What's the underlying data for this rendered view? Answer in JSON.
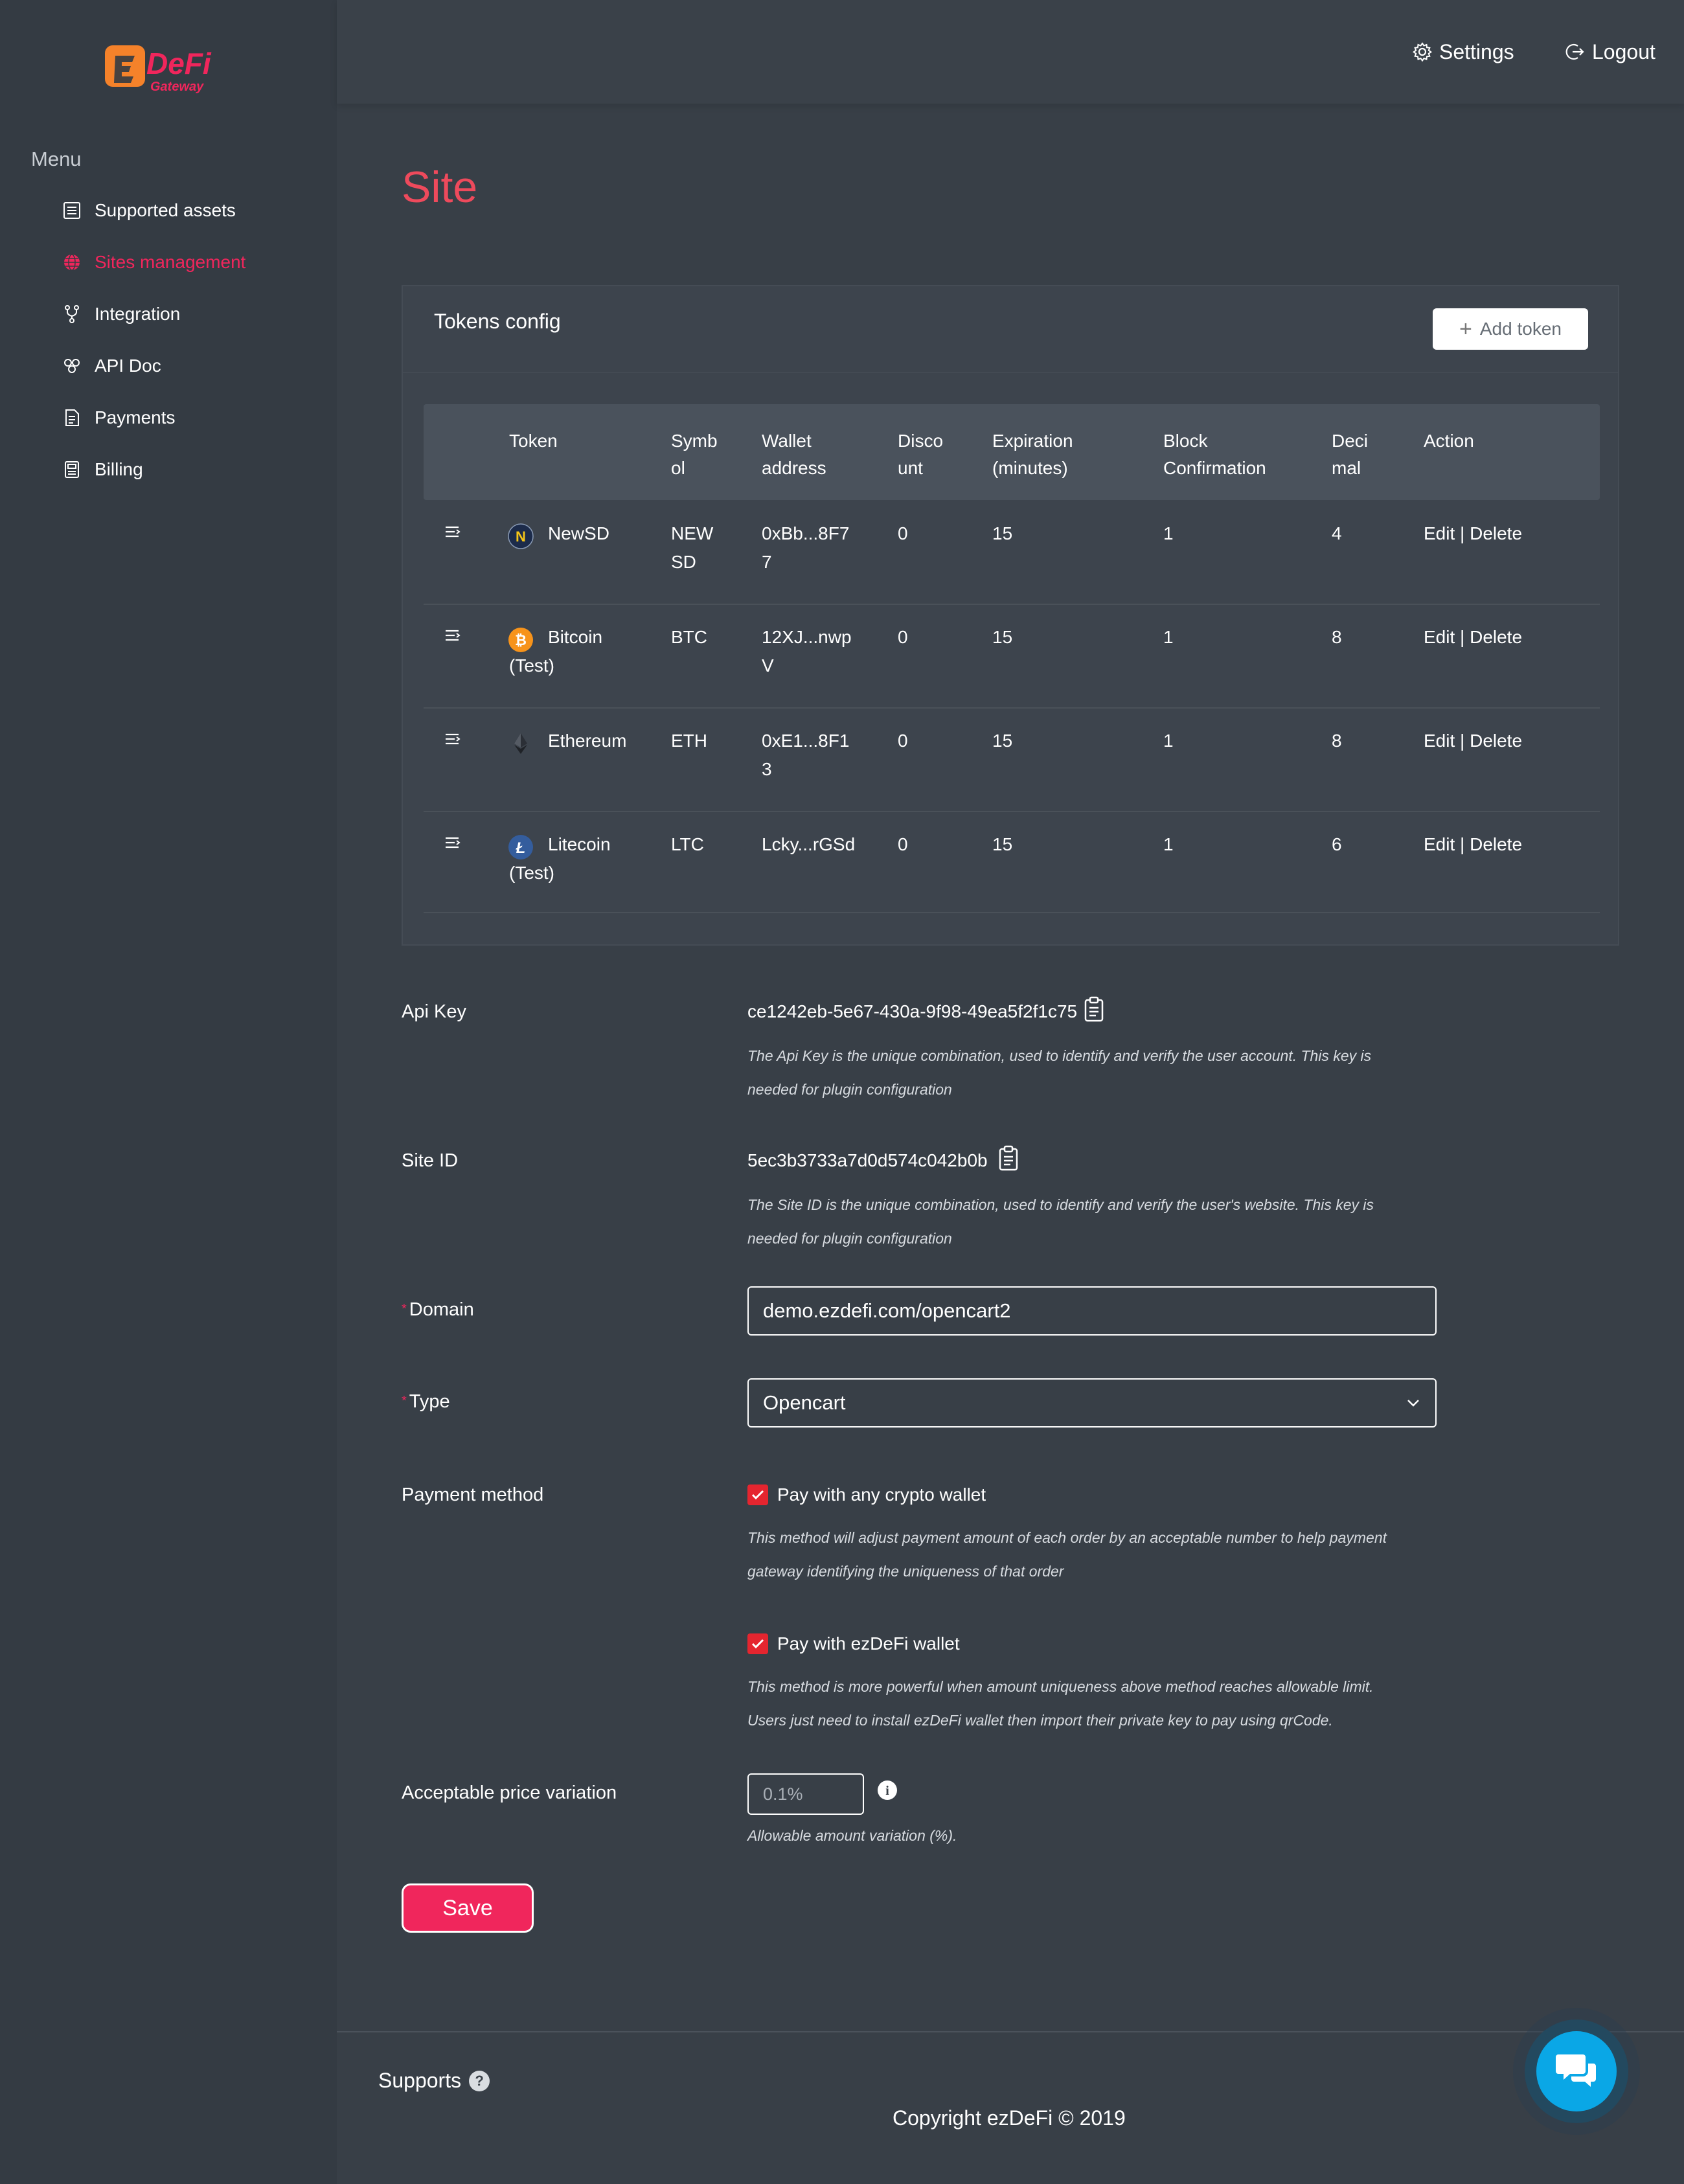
{
  "brand": {
    "logo_text": "ezDeFi",
    "logo_sub": "Gateway",
    "accent": "#f0265c",
    "logo_orange": "#f5822a"
  },
  "sidebar": {
    "menu_title": "Menu",
    "items": [
      {
        "label": "Supported assets",
        "icon": "list-icon",
        "active": false
      },
      {
        "label": "Sites management",
        "icon": "globe-icon",
        "active": true
      },
      {
        "label": "Integration",
        "icon": "fork-icon",
        "active": false
      },
      {
        "label": "API Doc",
        "icon": "api-icon",
        "active": false
      },
      {
        "label": "Payments",
        "icon": "document-icon",
        "active": false
      },
      {
        "label": "Billing",
        "icon": "receipt-icon",
        "active": false
      }
    ]
  },
  "header": {
    "settings_label": "Settings",
    "logout_label": "Logout"
  },
  "page": {
    "title": "Site"
  },
  "tokens": {
    "title": "Tokens config",
    "add_label": "Add token",
    "columns": [
      [
        "Token"
      ],
      [
        "Symb",
        "ol"
      ],
      [
        "Wallet",
        "address"
      ],
      [
        "Disco",
        "unt"
      ],
      [
        "Expiration",
        "(minutes)"
      ],
      [
        "Block",
        "Confirmation"
      ],
      [
        "Deci",
        "mal"
      ],
      [
        "Action"
      ]
    ],
    "edit_label": "Edit",
    "delete_label": "Delete",
    "rows": [
      {
        "name": [
          "NewSD"
        ],
        "coin": "newsd-coin-icon",
        "symbol": [
          "NEW",
          "SD"
        ],
        "wallet": [
          "0xBb...8F7",
          "7"
        ],
        "discount": "0",
        "expiration": "15",
        "block": "1",
        "decimal": "4"
      },
      {
        "name": [
          "Bitcoin",
          "(Test)"
        ],
        "coin": "bitcoin-coin-icon",
        "symbol": [
          "BTC"
        ],
        "wallet": [
          "12XJ...nwp",
          "V"
        ],
        "discount": "0",
        "expiration": "15",
        "block": "1",
        "decimal": "8"
      },
      {
        "name": [
          "Ethereum"
        ],
        "coin": "ethereum-coin-icon",
        "symbol": [
          "ETH"
        ],
        "wallet": [
          "0xE1...8F1",
          "3"
        ],
        "discount": "0",
        "expiration": "15",
        "block": "1",
        "decimal": "8"
      },
      {
        "name": [
          "Litecoin",
          "(Test)"
        ],
        "coin": "litecoin-coin-icon",
        "symbol": [
          "LTC"
        ],
        "wallet": [
          "Lcky...rGSd"
        ],
        "discount": "0",
        "expiration": "15",
        "block": "1",
        "decimal": "6"
      }
    ]
  },
  "form": {
    "api_key": {
      "label": "Api Key",
      "value": "ce1242eb-5e67-430a-9f98-49ea5f2f1c75",
      "hint": [
        "The Api Key is the unique combination, used to identify and verify the user account. This key is",
        "needed for plugin configuration"
      ]
    },
    "site_id": {
      "label": "Site ID",
      "value": "5ec3b3733a7d0d574c042b0b",
      "hint": [
        "The Site ID is the unique combination, used to identify and verify the user's website. This key is",
        "needed for plugin configuration"
      ]
    },
    "domain": {
      "required_mark": "*",
      "label": "Domain",
      "value": "demo.ezdefi.com/opencart2"
    },
    "type": {
      "required_mark": "*",
      "label": "Type",
      "value": "Opencart"
    },
    "payment_method": {
      "label": "Payment method",
      "any_wallet": {
        "label": "Pay with any crypto wallet",
        "checked": true,
        "hint": [
          "This method will adjust payment amount of each order by an acceptable number to help payment",
          "gateway identifying the uniqueness of that order"
        ]
      },
      "ezdefi_wallet": {
        "label": "Pay with ezDeFi wallet",
        "checked": true,
        "hint": [
          "This method is more powerful when amount uniqueness above method reaches allowable limit.",
          "Users just need to install ezDeFi wallet then import their private key to pay using qrCode."
        ]
      }
    },
    "variation": {
      "label": "Acceptable price variation",
      "placeholder": "0.1%",
      "hint": "Allowable amount variation (%)."
    },
    "save_label": "Save"
  },
  "footer": {
    "supports_label": "Supports",
    "copyright": "Copyright ezDeFi © 2019"
  }
}
